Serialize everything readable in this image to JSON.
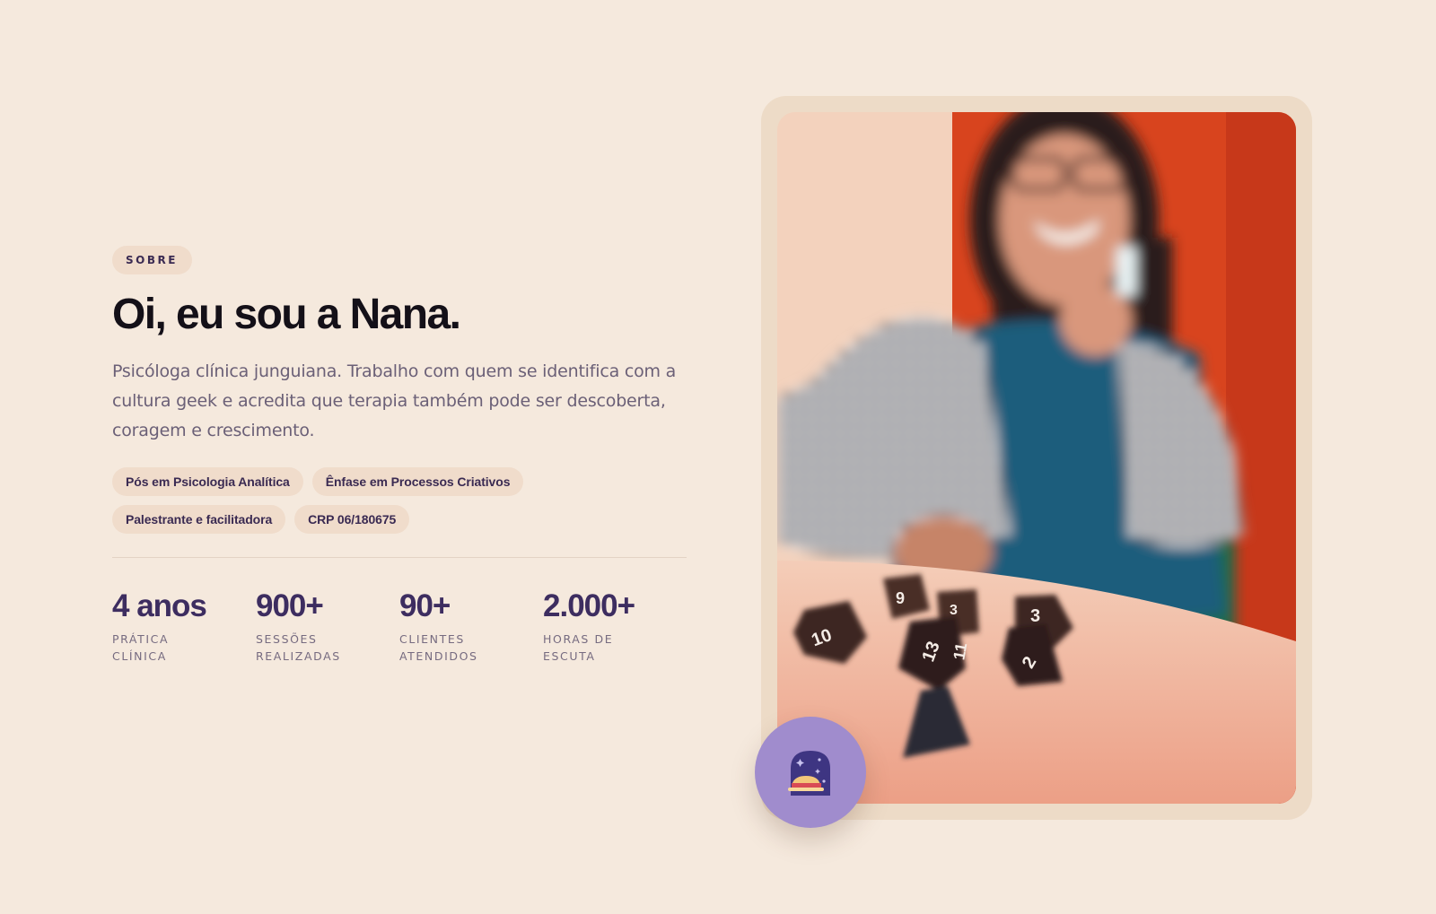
{
  "about": {
    "eyebrow": "SOBRE",
    "title": "Oi, eu sou a Nana.",
    "lead": "Psicóloga clínica junguiana. Trabalho com quem se identifica com a cultura geek e acredita que terapia também pode ser descoberta, coragem e crescimento.",
    "chips": [
      "Pós em Psicologia Analítica",
      "Ênfase em Processos Criativos",
      "Palestrante e facilitadora",
      "CRP 06/180675"
    ],
    "stats": [
      {
        "value": "4 anos",
        "label": "PRÁTICA CLÍNICA"
      },
      {
        "value": "900+",
        "label": "SESSÕES REALIZADAS"
      },
      {
        "value": "90+",
        "label": "CLIENTES ATENDIDOS"
      },
      {
        "value": "2.000+",
        "label": "HORAS DE ESCUTA"
      }
    ]
  },
  "photo": {
    "icon": "portrait-photo",
    "colors": {
      "wall_red": "#d5431f",
      "wall_cream": "#f3d4c0",
      "table": "#f2c2ab",
      "dress": "#1f5a7a"
    }
  },
  "badge": {
    "icon": "mushroom-hat-icon",
    "color": "#a08ccd"
  }
}
